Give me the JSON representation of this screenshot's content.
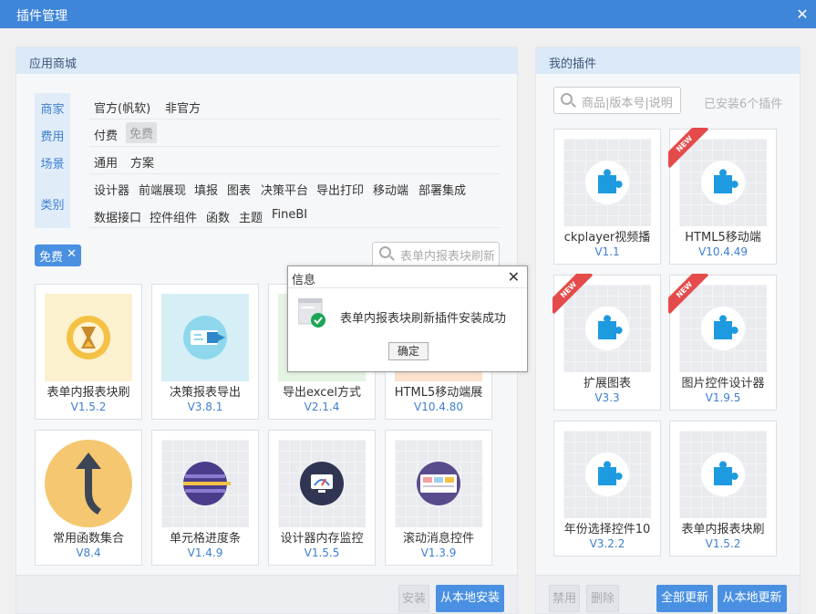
{
  "window": {
    "title": "插件管理",
    "close_icon": "close-icon"
  },
  "store": {
    "header": "应用商城",
    "filters": {
      "merchant": {
        "label": "商家",
        "options": [
          "官方(帆软)",
          "非官方"
        ]
      },
      "fee": {
        "label": "费用",
        "options": [
          "付费",
          "免费"
        ],
        "selected": "免费"
      },
      "scene": {
        "label": "场景",
        "options": [
          "通用",
          "方案"
        ]
      },
      "category": {
        "label": "类别",
        "options": [
          "设计器",
          "前端展现",
          "填报",
          "图表",
          "决策平台",
          "导出打印",
          "移动端",
          "部署集成",
          "数据接口",
          "控件组件",
          "函数",
          "主题",
          "FineBI"
        ]
      }
    },
    "active_tag": {
      "label": "免费",
      "remove": "✕"
    },
    "search_placeholder": "表单内报表块刷新",
    "plugins": [
      {
        "name": "表单内报表块刷",
        "version": "V1.5.2",
        "icon": "hourglass-icon"
      },
      {
        "name": "决策报表导出",
        "version": "V3.8.1",
        "icon": "export-icon"
      },
      {
        "name": "导出excel方式",
        "version": "V2.1.4",
        "icon": "excel-icon"
      },
      {
        "name": "HTML5移动端展",
        "version": "V10.4.80",
        "icon": "mobile-icon"
      },
      {
        "name": "常用函数集合",
        "version": "V8.4",
        "icon": "function-arrow-icon"
      },
      {
        "name": "单元格进度条",
        "version": "V1.4.9",
        "icon": "progress-bar-icon"
      },
      {
        "name": "设计器内存监控",
        "version": "V1.5.5",
        "icon": "monitor-gauge-icon"
      },
      {
        "name": "滚动消息控件",
        "version": "V1.3.9",
        "icon": "scroll-message-icon"
      }
    ],
    "buttons": {
      "install": "安装",
      "local_install": "从本地安装"
    }
  },
  "mine": {
    "header": "我的插件",
    "search_placeholder": "商品|版本号|说明",
    "installed_count": "已安装6个插件",
    "badge_new": "NEW",
    "plugins": [
      {
        "name": "ckplayer视频播",
        "version": "V1.1",
        "is_new": false
      },
      {
        "name": "HTML5移动端",
        "version": "V10.4.49",
        "is_new": true
      },
      {
        "name": "扩展图表",
        "version": "V3.3",
        "is_new": true
      },
      {
        "name": "图片控件设计器",
        "version": "V1.9.5",
        "is_new": true
      },
      {
        "name": "年份选择控件10",
        "version": "V3.2.2",
        "is_new": false
      },
      {
        "name": "表单内报表块刷",
        "version": "V1.5.2",
        "is_new": false
      }
    ],
    "buttons": {
      "disable": "禁用",
      "delete": "删除",
      "update_all": "全部更新",
      "local_update": "从本地更新"
    }
  },
  "dialog": {
    "title": "信息",
    "message": "表单内报表块刷新插件安装成功",
    "ok": "确定",
    "icon": "success-check-icon"
  },
  "colors": {
    "accent": "#4a90e2",
    "titlebar": "#3f86d9",
    "panel_header": "#dbe9f9",
    "version_text": "#3d7fd1",
    "new_badge": "#e64b4b"
  }
}
